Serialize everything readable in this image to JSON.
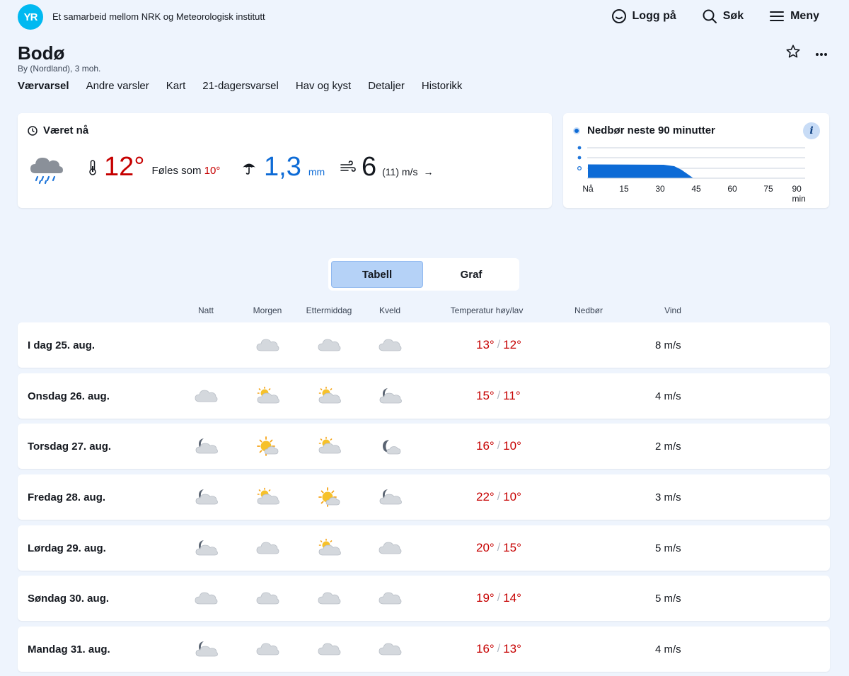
{
  "header": {
    "logo_text": "YR",
    "tagline": "Et samarbeid mellom NRK og Meteorologisk institutt",
    "nav": [
      {
        "label": "Logg på",
        "icon": "smiley-icon"
      },
      {
        "label": "Søk",
        "icon": "search-icon"
      },
      {
        "label": "Meny",
        "icon": "hamburger-icon"
      }
    ]
  },
  "location": {
    "name": "Bodø",
    "subtitle": "By (Nordland), 3 moh."
  },
  "tabs": [
    "Værvarsel",
    "Andre varsler",
    "Kart",
    "21-dagersvarsel",
    "Hav og kyst",
    "Detaljer",
    "Historikk"
  ],
  "now": {
    "title": "Været nå",
    "symbol": "rain-cloud",
    "temperature": "12°",
    "feels_label": "Føles som",
    "feels_value": "10°",
    "precip_value": "1,3",
    "precip_unit": "mm",
    "wind_value": "6",
    "wind_gust": "(11) m/s",
    "wind_dir_arrow": "→"
  },
  "precip90": {
    "title": "Nedbør neste 90 minutter",
    "info": "i",
    "axis": [
      "Nå",
      "15",
      "30",
      "45",
      "60",
      "75",
      "90 min"
    ],
    "colors": {
      "fill": "#0d6bd6",
      "grid": "#c8d2de"
    }
  },
  "view_toggle": {
    "table": "Tabell",
    "graph": "Graf"
  },
  "table": {
    "headers": {
      "night": "Natt",
      "morning": "Morgen",
      "afternoon": "Ettermiddag",
      "evening": "Kveld",
      "temp": "Temperatur høy/lav",
      "precip": "Nedbør",
      "wind": "Vind"
    },
    "rows": [
      {
        "day": "I dag 25. aug.",
        "symbols": [
          "",
          "cloud",
          "cloud",
          "cloud"
        ],
        "high": "13°",
        "low": "12°",
        "wind": "8 m/s"
      },
      {
        "day": "Onsdag 26. aug.",
        "symbols": [
          "cloud",
          "sun-cloud",
          "sun-cloud",
          "moon-cloud"
        ],
        "high": "15°",
        "low": "11°",
        "wind": "4 m/s"
      },
      {
        "day": "Torsdag 27. aug.",
        "symbols": [
          "moon-cloud",
          "sun-small-cloud",
          "sun-cloud",
          "moon-small-cloud"
        ],
        "high": "16°",
        "low": "10°",
        "wind": "2 m/s"
      },
      {
        "day": "Fredag 28. aug.",
        "symbols": [
          "moon-cloud",
          "sun-cloud",
          "sun-small-cloud",
          "moon-cloud"
        ],
        "high": "22°",
        "low": "10°",
        "wind": "3 m/s"
      },
      {
        "day": "Lørdag 29. aug.",
        "symbols": [
          "moon-cloud",
          "cloud",
          "sun-cloud",
          "cloud"
        ],
        "high": "20°",
        "low": "15°",
        "wind": "5 m/s"
      },
      {
        "day": "Søndag 30. aug.",
        "symbols": [
          "cloud",
          "cloud",
          "cloud",
          "cloud"
        ],
        "high": "19°",
        "low": "14°",
        "wind": "5 m/s"
      },
      {
        "day": "Mandag 31. aug.",
        "symbols": [
          "moon-cloud",
          "cloud",
          "cloud",
          "cloud"
        ],
        "high": "16°",
        "low": "13°",
        "wind": "4 m/s"
      }
    ]
  }
}
